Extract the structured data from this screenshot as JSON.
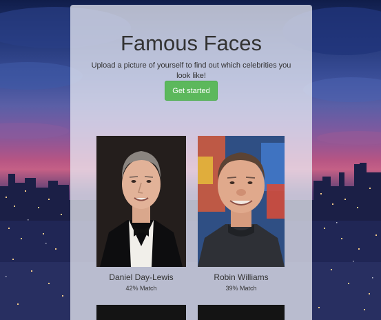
{
  "app": {
    "title": "Famous Faces",
    "subtitle": "Upload a picture of yourself to find out which celebrities you look like!",
    "cta_label": "Get started"
  },
  "matches": [
    {
      "name": "Daniel Day-Lewis",
      "match": "42% Match",
      "match_percent": 42,
      "photo_icon": "portrait-photo"
    },
    {
      "name": "Robin Williams",
      "match": "39% Match",
      "match_percent": 39,
      "photo_icon": "portrait-photo"
    }
  ],
  "colors": {
    "accent": "#5cb85c",
    "panel": "#eceef6",
    "text": "#333333"
  }
}
